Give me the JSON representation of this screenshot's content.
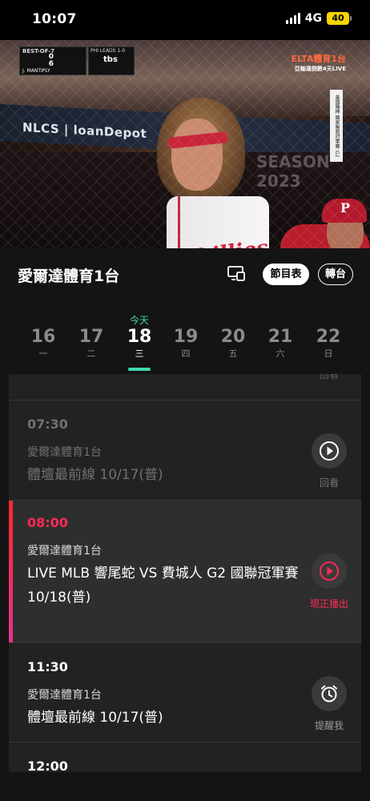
{
  "status": {
    "time": "10:07",
    "network": "4G",
    "battery": "40"
  },
  "video": {
    "banner": "NLCS | loanDepot",
    "season_text": "SEASON 2023",
    "scorebug": {
      "header": "BEST-OF-7",
      "team1_score": "0",
      "team2_score": "6",
      "pitcher": "J. MANTIPLY",
      "count": "P 9"
    },
    "series_box": {
      "header": "PHI LEADS 1-0",
      "network": "tbs"
    },
    "channel_logo": {
      "brand": "ELTA體育1台",
      "sub": "亞軸運倒數4天LIVE"
    },
    "side_tag": "美國職棒 國家聯盟冠軍賽 G2",
    "jersey_text": "Phillies"
  },
  "channel": {
    "name": "愛爾達體育1台",
    "guide_label": "節目表",
    "switch_label": "轉台"
  },
  "dates": {
    "today_label": "今天",
    "days": [
      {
        "num": "16",
        "wk": "一"
      },
      {
        "num": "17",
        "wk": "二"
      },
      {
        "num": "18",
        "wk": "三"
      },
      {
        "num": "19",
        "wk": "四"
      },
      {
        "num": "20",
        "wk": "五"
      },
      {
        "num": "21",
        "wk": "六"
      },
      {
        "num": "22",
        "wk": "日"
      }
    ]
  },
  "programs": [
    {
      "time": "",
      "channel": "",
      "title": "",
      "action": "回看"
    },
    {
      "time": "07:30",
      "channel": "愛爾達體育1台",
      "title": "體壇最前線 10/17(普)",
      "action": "回看"
    },
    {
      "time": "08:00",
      "channel": "愛爾達體育1台",
      "title": "LIVE MLB 響尾蛇 VS 費城人 G2 國聯冠軍賽 10/18(普)",
      "action": "現正播出"
    },
    {
      "time": "11:30",
      "channel": "愛爾達體育1台",
      "title": "體壇最前線 10/17(普)",
      "action": "提醒我"
    },
    {
      "time": "12:00",
      "channel": "",
      "title": "",
      "action": ""
    }
  ],
  "colors": {
    "accent_teal": "#3fd9b3",
    "live_red": "#ff2a55"
  }
}
